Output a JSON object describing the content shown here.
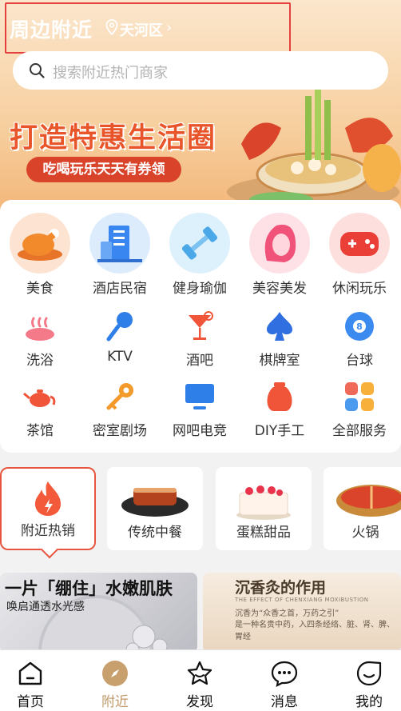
{
  "header": {
    "title": "周边附近",
    "district": "天河区",
    "chevron": "›"
  },
  "search": {
    "placeholder": "搜索附近热门商家"
  },
  "banner": {
    "title": "打造特惠生活圈",
    "subtitle": "吃喝玩乐天天有券领"
  },
  "categories_primary": [
    {
      "label": "美食",
      "icon": "roast-chicken-icon"
    },
    {
      "label": "酒店民宿",
      "icon": "hotel-building-icon"
    },
    {
      "label": "健身瑜伽",
      "icon": "dumbbell-icon"
    },
    {
      "label": "美容美发",
      "icon": "woman-face-icon"
    },
    {
      "label": "休闲玩乐",
      "icon": "gamepad-icon"
    }
  ],
  "categories_secondary": [
    {
      "label": "洗浴",
      "icon": "hot-spring-icon"
    },
    {
      "label": "KTV",
      "icon": "microphone-icon"
    },
    {
      "label": "酒吧",
      "icon": "cocktail-icon"
    },
    {
      "label": "棋牌室",
      "icon": "spade-icon"
    },
    {
      "label": "台球",
      "icon": "billiard-ball-icon"
    },
    {
      "label": "茶馆",
      "icon": "teapot-icon"
    },
    {
      "label": "密室剧场",
      "icon": "key-icon"
    },
    {
      "label": "网吧电竞",
      "icon": "monitor-icon"
    },
    {
      "label": "DIY手工",
      "icon": "vase-icon"
    },
    {
      "label": "全部服务",
      "icon": "grid-icon"
    }
  ],
  "food_cards": [
    {
      "label": "附近热销",
      "active": true
    },
    {
      "label": "传统中餐",
      "active": false
    },
    {
      "label": "蛋糕甜品",
      "active": false
    },
    {
      "label": "火锅",
      "active": false
    }
  ],
  "promos": [
    {
      "title": "一片「绷住」水嫩肌肤",
      "subtitle": "唤启通透水光感"
    },
    {
      "title": "沉香灸的作用",
      "subtitle": "THE EFFECT OF CHENXIANG MOXIBUSTION",
      "line1": "沉香为“众香之首，万药之引”",
      "line2": "是一种名贵中药，入四条经络、脏、肾、脾、胃经"
    }
  ],
  "tabbar": [
    {
      "label": "首页",
      "icon": "home-icon",
      "active": false
    },
    {
      "label": "附近",
      "icon": "compass-icon",
      "active": true
    },
    {
      "label": "发现",
      "icon": "star-icon",
      "active": false
    },
    {
      "label": "消息",
      "icon": "chat-bubble-icon",
      "active": false
    },
    {
      "label": "我的",
      "icon": "smile-face-icon",
      "active": false
    }
  ],
  "colors": {
    "accent": "#e8553e",
    "tab_active": "#c09a6a",
    "banner_title": "#e8552a",
    "hero_top": "#fbe6cc",
    "hero_bottom": "#f3b77b"
  }
}
